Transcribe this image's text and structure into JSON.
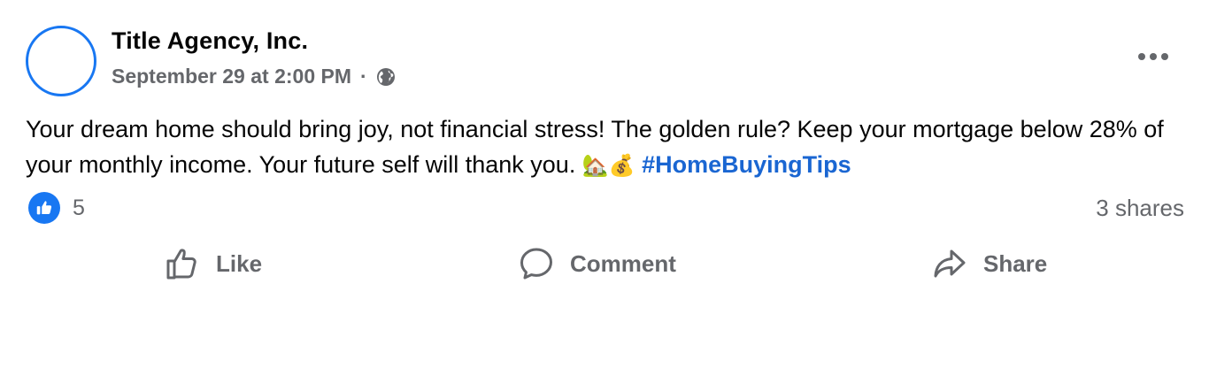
{
  "post": {
    "author": "Title Agency, Inc.",
    "timestamp": "September 29 at 2:00 PM",
    "separator": "·",
    "privacy_icon": "globe-icon",
    "text_main": "Your dream home should bring joy, not financial stress! The golden rule? Keep your mortgage below 28% of your monthly income. Your future self will thank you.",
    "emoji_1": "🏡",
    "emoji_2": "💰",
    "hashtag": "#HomeBuyingTips"
  },
  "stats": {
    "reaction_icon": "like-icon",
    "reaction_count": "5",
    "shares": "3 shares"
  },
  "actions": {
    "like_label": "Like",
    "comment_label": "Comment",
    "share_label": "Share"
  },
  "colors": {
    "accent": "#1877f2",
    "hashtag": "#1a66d2",
    "secondary_text": "#65676b"
  }
}
